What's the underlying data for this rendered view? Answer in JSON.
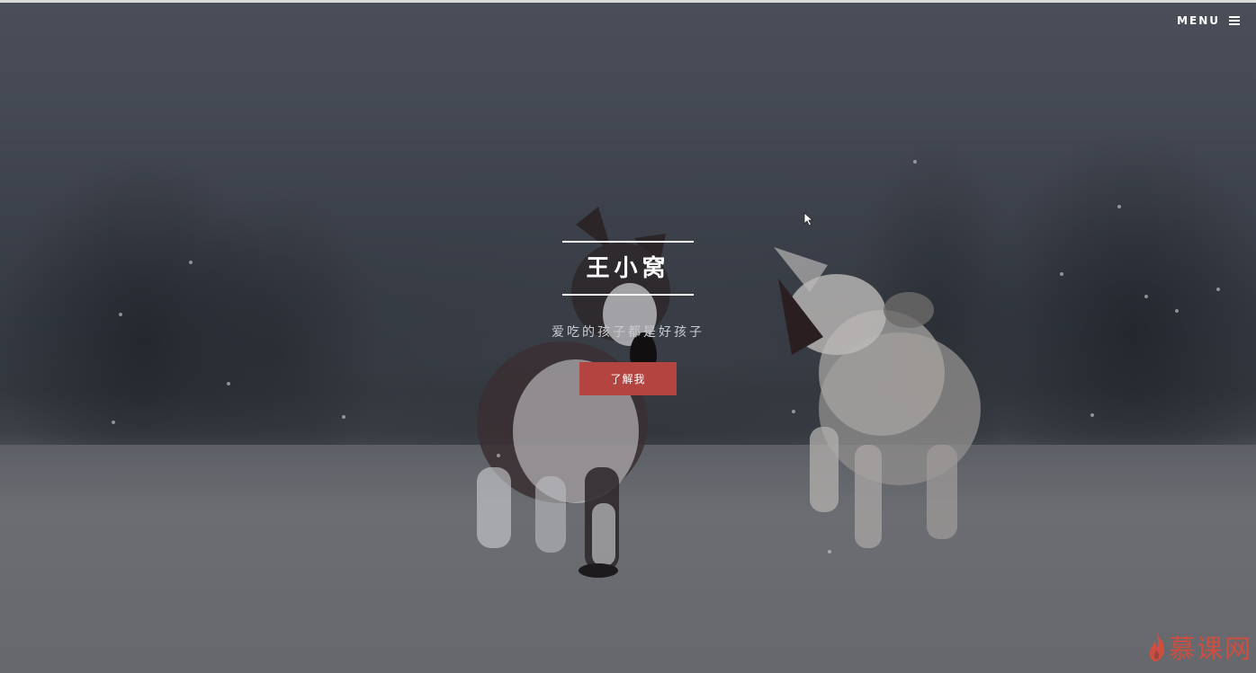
{
  "header": {
    "menu_label": "MENU"
  },
  "hero": {
    "title": "王小窝",
    "subtitle": "爱吃的孩子都是好孩子",
    "button_label": "了解我"
  },
  "watermark": {
    "text": "慕课网"
  },
  "colors": {
    "accent": "#b3443f",
    "text": "#ffffff",
    "watermark": "#e04a38"
  },
  "icons": {
    "menu": "hamburger-icon",
    "cursor": "cursor-icon"
  }
}
